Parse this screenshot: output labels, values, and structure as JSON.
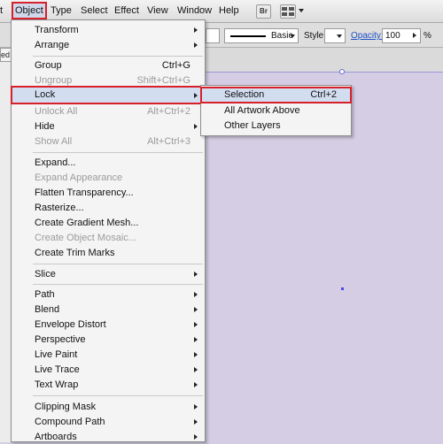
{
  "menubar": {
    "partial_left": "t",
    "items": [
      "Object",
      "Type",
      "Select",
      "Effect",
      "View",
      "Window",
      "Help"
    ],
    "bridge_label": "Br",
    "workspace_icon": "arrange-documents-icon"
  },
  "toolbar": {
    "stroke_style": "Basic",
    "style_label": "Style:",
    "opacity_label": "Opacity:",
    "opacity_value": "100",
    "percent_sign": "%",
    "left_tab_stub": "ed"
  },
  "object_menu": {
    "items": [
      {
        "label": "Transform",
        "shortcut": "",
        "submenu": true,
        "disabled": false
      },
      {
        "label": "Arrange",
        "shortcut": "",
        "submenu": true,
        "disabled": false
      },
      {
        "label": "Group",
        "shortcut": "Ctrl+G",
        "submenu": false,
        "disabled": false
      },
      {
        "label": "Ungroup",
        "shortcut": "Shift+Ctrl+G",
        "submenu": false,
        "disabled": true
      },
      {
        "label": "Lock",
        "shortcut": "",
        "submenu": true,
        "disabled": false,
        "highlighted": true
      },
      {
        "label": "Unlock All",
        "shortcut": "Alt+Ctrl+2",
        "submenu": false,
        "disabled": true
      },
      {
        "label": "Hide",
        "shortcut": "",
        "submenu": true,
        "disabled": false
      },
      {
        "label": "Show All",
        "shortcut": "Alt+Ctrl+3",
        "submenu": false,
        "disabled": true
      },
      {
        "label": "Expand...",
        "shortcut": "",
        "submenu": false,
        "disabled": false
      },
      {
        "label": "Expand Appearance",
        "shortcut": "",
        "submenu": false,
        "disabled": true
      },
      {
        "label": "Flatten Transparency...",
        "shortcut": "",
        "submenu": false,
        "disabled": false
      },
      {
        "label": "Rasterize...",
        "shortcut": "",
        "submenu": false,
        "disabled": false
      },
      {
        "label": "Create Gradient Mesh...",
        "shortcut": "",
        "submenu": false,
        "disabled": false
      },
      {
        "label": "Create Object Mosaic...",
        "shortcut": "",
        "submenu": false,
        "disabled": true
      },
      {
        "label": "Create Trim Marks",
        "shortcut": "",
        "submenu": false,
        "disabled": false
      },
      {
        "label": "Slice",
        "shortcut": "",
        "submenu": true,
        "disabled": false
      },
      {
        "label": "Path",
        "shortcut": "",
        "submenu": true,
        "disabled": false
      },
      {
        "label": "Blend",
        "shortcut": "",
        "submenu": true,
        "disabled": false
      },
      {
        "label": "Envelope Distort",
        "shortcut": "",
        "submenu": true,
        "disabled": false
      },
      {
        "label": "Perspective",
        "shortcut": "",
        "submenu": true,
        "disabled": false
      },
      {
        "label": "Live Paint",
        "shortcut": "",
        "submenu": true,
        "disabled": false
      },
      {
        "label": "Live Trace",
        "shortcut": "",
        "submenu": true,
        "disabled": false
      },
      {
        "label": "Text Wrap",
        "shortcut": "",
        "submenu": true,
        "disabled": false
      },
      {
        "label": "Clipping Mask",
        "shortcut": "",
        "submenu": true,
        "disabled": false
      },
      {
        "label": "Compound Path",
        "shortcut": "",
        "submenu": true,
        "disabled": false
      },
      {
        "label": "Artboards",
        "shortcut": "",
        "submenu": true,
        "disabled": false
      }
    ]
  },
  "lock_submenu": {
    "items": [
      {
        "label": "Selection",
        "shortcut": "Ctrl+2",
        "highlighted": true
      },
      {
        "label": "All Artwork Above",
        "shortcut": ""
      },
      {
        "label": "Other Layers",
        "shortcut": ""
      }
    ]
  },
  "colors": {
    "highlight_outline": "#d8202a",
    "menu_highlight": "#d3ddf0",
    "canvas": "#d4cde3"
  }
}
